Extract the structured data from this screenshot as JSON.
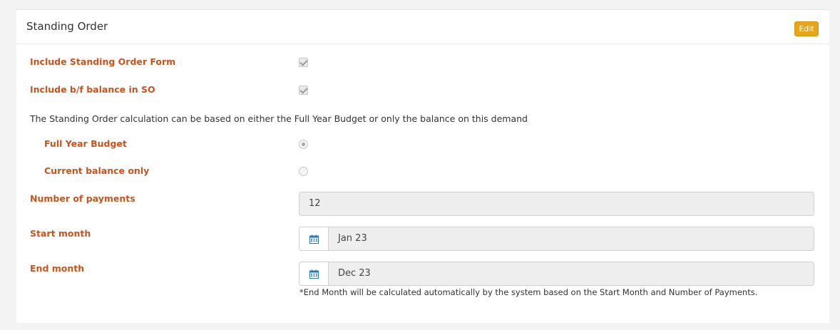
{
  "panel": {
    "title": "Standing Order",
    "edit_label": "Edit"
  },
  "form": {
    "include_so_form": {
      "label": "Include Standing Order Form",
      "checked": true
    },
    "include_bf_balance": {
      "label": "Include b/f balance in SO",
      "checked": true
    },
    "calc_info": "The Standing Order calculation can be based on either the Full Year Budget or only the balance on this demand",
    "full_year_budget": {
      "label": "Full Year Budget",
      "selected": true
    },
    "current_balance_only": {
      "label": "Current balance only",
      "selected": false
    },
    "number_of_payments": {
      "label": "Number of payments",
      "value": "12"
    },
    "start_month": {
      "label": "Start month",
      "value": "Jan 23"
    },
    "end_month": {
      "label": "End month",
      "value": "Dec 23"
    },
    "end_month_hint": "*End Month will be calculated automatically by the system based on the Start Month and Number of Payments."
  },
  "colors": {
    "label": "#c8541d",
    "edit_button": "#e8a617",
    "calendar_icon": "#2a7ab8"
  },
  "icons": {
    "calendar": "calendar-icon"
  }
}
